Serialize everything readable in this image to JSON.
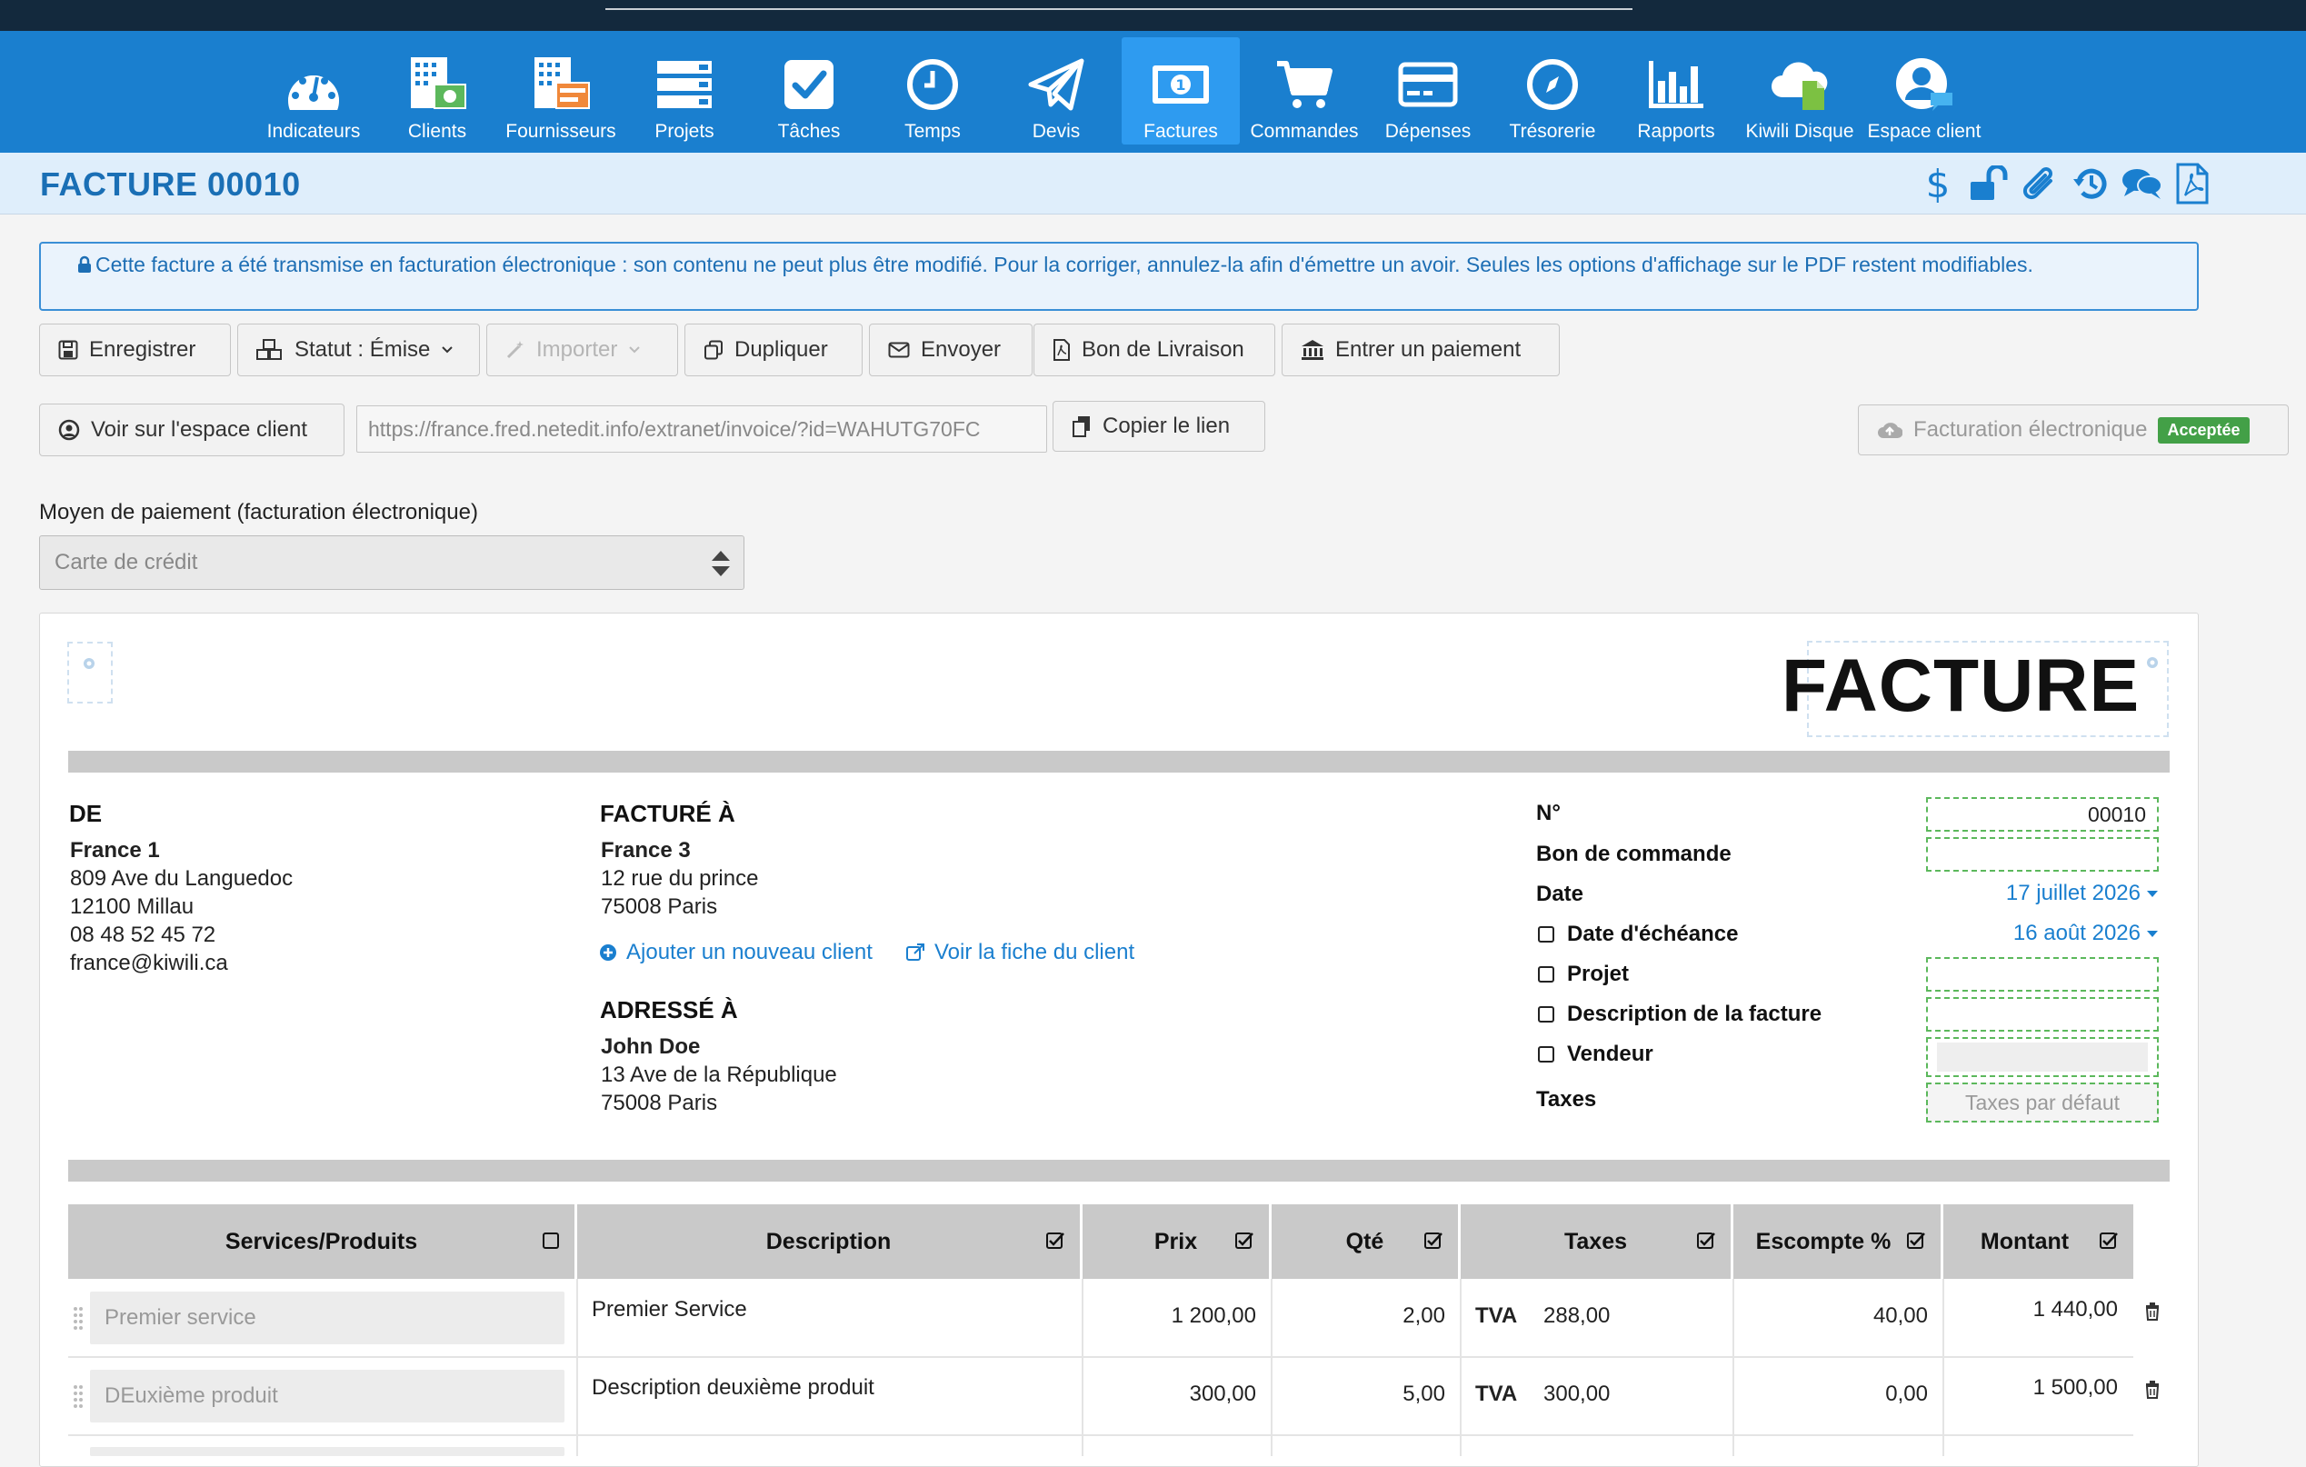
{
  "nav": {
    "items": [
      {
        "label": "Indicateurs",
        "icon": "gauge-icon"
      },
      {
        "label": "Clients",
        "icon": "clients-building-icon"
      },
      {
        "label": "Fournisseurs",
        "icon": "suppliers-building-icon"
      },
      {
        "label": "Projets",
        "icon": "projects-stack-icon"
      },
      {
        "label": "Tâches",
        "icon": "task-check-icon"
      },
      {
        "label": "Temps",
        "icon": "clock-icon"
      },
      {
        "label": "Devis",
        "icon": "paper-plane-icon"
      },
      {
        "label": "Factures",
        "icon": "banknote-icon",
        "active": true
      },
      {
        "label": "Commandes",
        "icon": "cart-icon"
      },
      {
        "label": "Dépenses",
        "icon": "credit-card-icon"
      },
      {
        "label": "Trésorerie",
        "icon": "compass-icon"
      },
      {
        "label": "Rapports",
        "icon": "bar-chart-icon"
      },
      {
        "label": "Kiwili Disque",
        "icon": "cloud-file-icon"
      },
      {
        "label": "Espace client",
        "icon": "user-chat-icon"
      }
    ]
  },
  "header": {
    "title": "FACTURE 00010",
    "icons": [
      "dollar-icon",
      "unlock-icon",
      "paperclip-icon",
      "history-icon",
      "comments-icon",
      "pdf-file-icon"
    ]
  },
  "alert": {
    "text": "Cette facture a été transmise en facturation électronique : son contenu ne peut plus être modifié. Pour la corriger, annulez-la afin d'émettre un avoir. Seules les options d'affichage sur le PDF restent modifiables."
  },
  "toolbar": {
    "save": "Enregistrer",
    "status": "Statut : Émise",
    "import": "Importer",
    "duplicate": "Dupliquer",
    "send": "Envoyer",
    "delivery": "Bon de Livraison",
    "payment": "Entrer un paiement"
  },
  "client_portal": {
    "view": "Voir sur l'espace client",
    "url": "https://france.fred.netedit.info/extranet/invoice/?id=WAHUTG70FC",
    "copy": "Copier le lien"
  },
  "einvoice": {
    "label": "Facturation électronique",
    "status": "Acceptée",
    "status_color": "#43a047"
  },
  "payment_method": {
    "label": "Moyen de paiement (facturation électronique)",
    "value": "Carte de crédit"
  },
  "invoice": {
    "doc_title": "FACTURE",
    "from": {
      "heading": "DE",
      "name": "France 1",
      "address1": "809 Ave du Languedoc",
      "address2": "12100 Millau",
      "phone": "08 48 52 45 72",
      "email": "france@kiwili.ca"
    },
    "billed_to": {
      "heading": "FACTURÉ À",
      "name": "France 3",
      "address1": "12 rue du prince",
      "address2": "75008 Paris",
      "add_client": "Ajouter un nouveau client",
      "view_client": "Voir la fiche du client"
    },
    "ship_to": {
      "heading": "ADRESSÉ À",
      "name": "John Doe",
      "address1": "13 Ave de la République",
      "address2": "75008 Paris"
    },
    "meta": {
      "number_label": "N°",
      "number": "00010",
      "po_label": "Bon de commande",
      "po": "",
      "date_label": "Date",
      "date": "17 juillet 2026",
      "due_label": "Date d'échéance",
      "due": "16 août 2026",
      "project_label": "Projet",
      "description_label": "Description de la facture",
      "seller_label": "Vendeur",
      "taxes_label": "Taxes",
      "taxes_placeholder": "Taxes par défaut"
    },
    "table": {
      "headers": {
        "product": "Services/Produits",
        "description": "Description",
        "price": "Prix",
        "qty": "Qté",
        "taxes": "Taxes",
        "discount": "Escompte %",
        "amount": "Montant"
      },
      "rows": [
        {
          "product": "Premier service",
          "description": "Premier Service",
          "price": "1 200,00",
          "qty": "2,00",
          "tax_name": "TVA",
          "tax": "288,00",
          "discount": "40,00",
          "amount": "1 440,00"
        },
        {
          "product": "DEuxième produit",
          "description": "Description deuxième produit",
          "price": "300,00",
          "qty": "5,00",
          "tax_name": "TVA",
          "tax": "300,00",
          "discount": "0,00",
          "amount": "1 500,00"
        }
      ]
    }
  },
  "colors": {
    "nav_bg": "#1a7fcf",
    "nav_active": "#2e9bf0",
    "title_color": "#1a6fb5",
    "alert_border": "#3a8fd6"
  }
}
